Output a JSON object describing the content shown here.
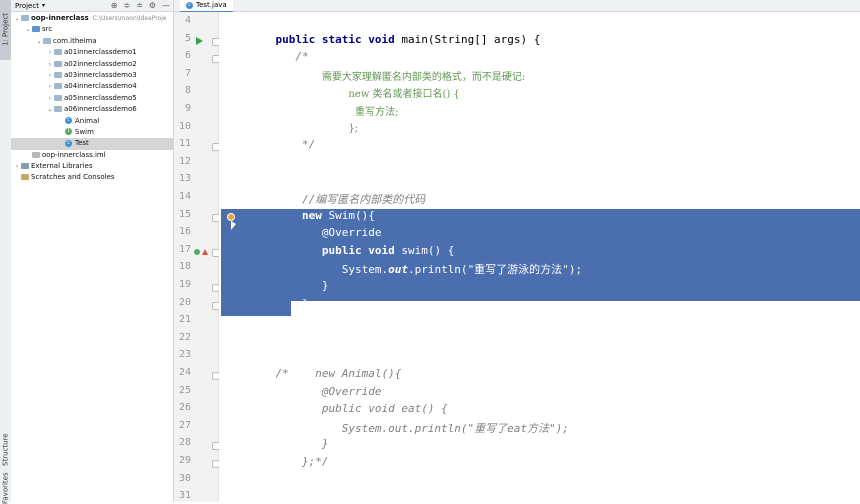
{
  "sidebar_tabs": {
    "project": "1: Project",
    "structure": "Structure",
    "favorites": "Favorites"
  },
  "project_panel": {
    "title": "Project",
    "tree": [
      {
        "label": "oop-innerclass",
        "path": "C:\\Users\\moon\\IdeaProje",
        "depth": 0,
        "expanded": true,
        "kind": "module"
      },
      {
        "label": "src",
        "depth": 1,
        "expanded": true,
        "kind": "src"
      },
      {
        "label": "com.itheima",
        "depth": 2,
        "expanded": true,
        "kind": "folder"
      },
      {
        "label": "a01innerclassdemo1",
        "depth": 3,
        "expanded": false,
        "kind": "folder"
      },
      {
        "label": "a02innerclassdemo2",
        "depth": 3,
        "expanded": false,
        "kind": "folder"
      },
      {
        "label": "a03innerclassdemo3",
        "depth": 3,
        "expanded": false,
        "kind": "folder"
      },
      {
        "label": "a04innerclassdemo4",
        "depth": 3,
        "expanded": false,
        "kind": "folder"
      },
      {
        "label": "a05innerclassdemo5",
        "depth": 3,
        "expanded": false,
        "kind": "folder"
      },
      {
        "label": "a06innerclassdemo6",
        "depth": 3,
        "expanded": true,
        "kind": "folder"
      },
      {
        "label": "Animal",
        "depth": 4,
        "kind": "class-c"
      },
      {
        "label": "Swim",
        "depth": 4,
        "kind": "class-i"
      },
      {
        "label": "Test",
        "depth": 4,
        "kind": "class-c",
        "selected": true
      },
      {
        "label": "oop-innerclass.iml",
        "depth": 1,
        "kind": "iml"
      },
      {
        "label": "External Libraries",
        "depth": 0,
        "expanded": false,
        "kind": "lib"
      },
      {
        "label": "Scratches and Consoles",
        "depth": 0,
        "kind": "scratch"
      }
    ]
  },
  "editor": {
    "tab_label": "Test.java",
    "line_numbers": [
      "4",
      "5",
      "6",
      "7",
      "8",
      "9",
      "10",
      "11",
      "12",
      "13",
      "14",
      "15",
      "16",
      "17",
      "18",
      "19",
      "20",
      "21",
      "22",
      "23",
      "24",
      "25",
      "26",
      "27",
      "28",
      "29",
      "30",
      "31"
    ],
    "lines": [
      {
        "n": "4",
        "parts": []
      },
      {
        "n": "5",
        "parts": [
          {
            "t": "    "
          },
          {
            "t": "public static void ",
            "c": "kw"
          },
          {
            "t": "main(String[] args) {"
          }
        ]
      },
      {
        "n": "6",
        "parts": [
          {
            "t": "       "
          },
          {
            "t": "/*",
            "c": "cm"
          }
        ]
      },
      {
        "n": "7",
        "parts": [
          {
            "t": "           "
          },
          {
            "t": "需要大家理解匿名内部类的格式，而不是硬记:",
            "c": "cmz"
          }
        ]
      },
      {
        "n": "8",
        "parts": [
          {
            "t": "               "
          },
          {
            "t": "new 类名或者接口名() {",
            "c": "cmz"
          }
        ]
      },
      {
        "n": "9",
        "parts": [
          {
            "t": "                "
          },
          {
            "t": "重写方法;",
            "c": "cmz"
          }
        ]
      },
      {
        "n": "10",
        "parts": [
          {
            "t": "               "
          },
          {
            "t": "};",
            "c": "cmz"
          }
        ]
      },
      {
        "n": "11",
        "parts": [
          {
            "t": "        "
          },
          {
            "t": "*/",
            "c": "cm"
          }
        ]
      },
      {
        "n": "12",
        "parts": []
      },
      {
        "n": "13",
        "parts": []
      },
      {
        "n": "14",
        "parts": [
          {
            "t": "        "
          },
          {
            "t": "//编写匿名内部类的代码",
            "c": "cm"
          }
        ]
      },
      {
        "n": "15",
        "sel": true,
        "parts": [
          {
            "t": "        "
          },
          {
            "t": "new ",
            "c": "kw"
          },
          {
            "t": "Swim(){"
          }
        ]
      },
      {
        "n": "16",
        "sel": true,
        "parts": [
          {
            "t": "           "
          },
          {
            "t": "@Override",
            "c": "an"
          }
        ]
      },
      {
        "n": "17",
        "sel": true,
        "parts": [
          {
            "t": "           "
          },
          {
            "t": "public void ",
            "c": "kw"
          },
          {
            "t": "swim() {"
          }
        ]
      },
      {
        "n": "18",
        "sel": true,
        "parts": [
          {
            "t": "              "
          },
          {
            "t": "System."
          },
          {
            "t": "out",
            "c": "it"
          },
          {
            "t": ".println("
          },
          {
            "t": "\"重写了游泳的方法\"",
            "c": "st"
          },
          {
            "t": ");"
          }
        ]
      },
      {
        "n": "19",
        "sel": true,
        "parts": [
          {
            "t": "           "
          },
          {
            "t": "}"
          }
        ]
      },
      {
        "n": "20",
        "sel": true,
        "parts": [
          {
            "t": "        "
          },
          {
            "t": "};"
          }
        ]
      },
      {
        "n": "21",
        "parts": []
      },
      {
        "n": "22",
        "parts": []
      },
      {
        "n": "23",
        "parts": []
      },
      {
        "n": "24",
        "parts": [
          {
            "t": "    "
          },
          {
            "t": "/*    new Animal(){",
            "c": "cm"
          }
        ]
      },
      {
        "n": "25",
        "parts": [
          {
            "t": "           "
          },
          {
            "t": "@Override",
            "c": "cm"
          }
        ]
      },
      {
        "n": "26",
        "parts": [
          {
            "t": "           "
          },
          {
            "t": "public void eat() {",
            "c": "cm"
          }
        ]
      },
      {
        "n": "27",
        "parts": [
          {
            "t": "              "
          },
          {
            "t": "System.out.println(\"重写了eat方法\");",
            "c": "cm"
          }
        ]
      },
      {
        "n": "28",
        "parts": [
          {
            "t": "           "
          },
          {
            "t": "}",
            "c": "cm"
          }
        ]
      },
      {
        "n": "29",
        "parts": [
          {
            "t": "        "
          },
          {
            "t": "};*/",
            "c": "cm"
          }
        ]
      },
      {
        "n": "30",
        "parts": []
      },
      {
        "n": "31",
        "parts": []
      }
    ]
  },
  "colors": {
    "selection": "#4b6eaf",
    "keyword": "#000080",
    "comment": "#808080",
    "string": "#008000",
    "annotation": "#808000"
  }
}
